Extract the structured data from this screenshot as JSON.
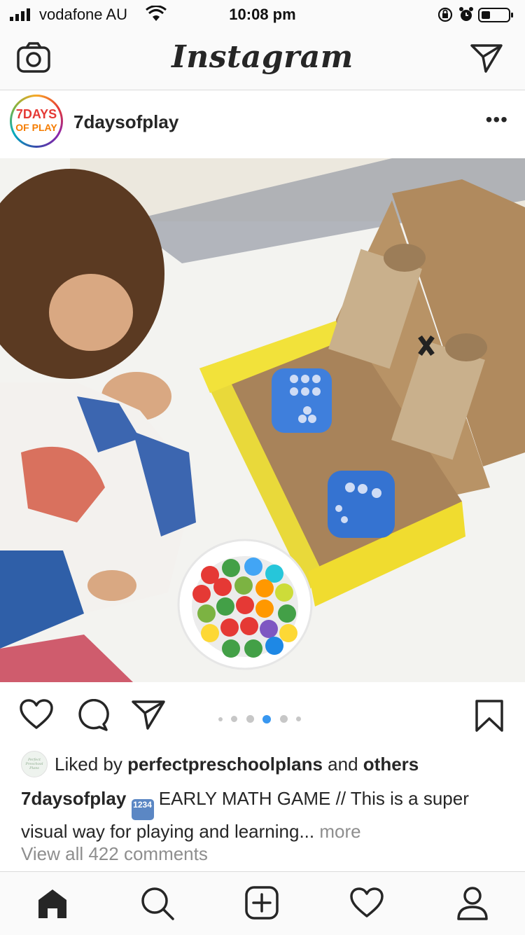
{
  "status_bar": {
    "carrier": "vodafone AU",
    "time": "10:08 pm"
  },
  "header": {
    "logo_text": "Instagram",
    "camera_icon": "camera-icon",
    "direct_icon": "paper-plane-icon"
  },
  "post": {
    "username": "7daysofplay",
    "avatar_text": [
      "7DAYS",
      "OF PLAY"
    ],
    "more_label": "•••",
    "carousel": {
      "count": 5,
      "active_index": 3
    },
    "liked_by": {
      "prefix": "Liked by",
      "user": "perfectpreschoolplans",
      "and": "and",
      "others": "others",
      "avatar_text": "Perfect Preschool Plans"
    },
    "caption": {
      "username": "7daysofplay",
      "emoji": "1234",
      "text": "EARLY MATH GAME // This is a super visual way for playing and learning...",
      "more": "more"
    },
    "view_comments": "View all 422 comments"
  },
  "tabbar": {
    "items": [
      "home-icon",
      "search-icon",
      "new-post-icon",
      "activity-heart-icon",
      "profile-icon"
    ]
  },
  "colors": {
    "accent_blue": "#3897f0",
    "text": "#262626",
    "muted": "#8e8e8e"
  }
}
